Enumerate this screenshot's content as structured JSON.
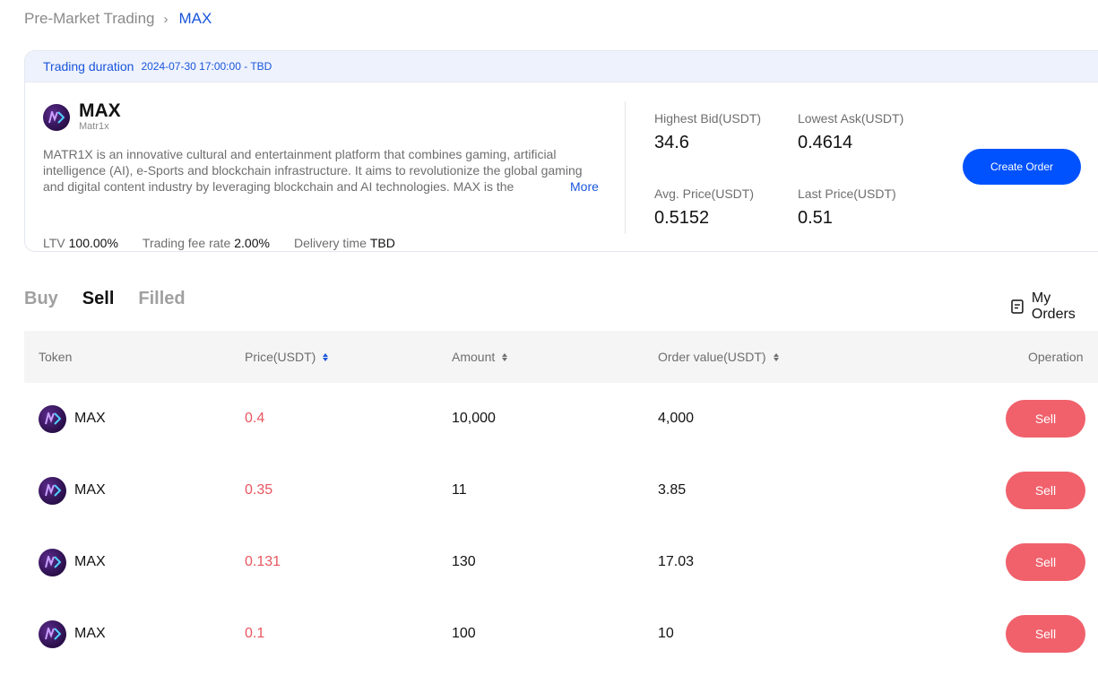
{
  "breadcrumb": {
    "parent": "Pre-Market Trading",
    "separator": "›",
    "current": "MAX"
  },
  "card": {
    "duration_label": "Trading duration",
    "duration_value": "2024-07-30 17:00:00 - TBD",
    "token": {
      "symbol": "MAX",
      "name": "Matr1x",
      "logo_icon": "matr1x-logo-icon"
    },
    "description": "MATR1X is an innovative cultural and entertainment platform that combines gaming, artificial intelligence (AI), e-Sports and blockchain infrastructure. It aims to revolutionize the global gaming and digital content industry by leveraging blockchain and AI technologies. MAX is the",
    "more_label": "More",
    "metrics": [
      {
        "label": "LTV",
        "value": "100.00%"
      },
      {
        "label": "Trading fee rate",
        "value": "2.00%"
      },
      {
        "label": "Delivery time",
        "value": "TBD"
      }
    ],
    "stats": {
      "highest_bid": {
        "label": "Highest Bid(USDT)",
        "value": "34.6"
      },
      "lowest_ask": {
        "label": "Lowest Ask(USDT)",
        "value": "0.4614"
      },
      "avg_price": {
        "label": "Avg. Price(USDT)",
        "value": "0.5152"
      },
      "last_price": {
        "label": "Last Price(USDT)",
        "value": "0.51"
      }
    },
    "create_order_label": "Create Order"
  },
  "tabs": [
    {
      "label": "Buy",
      "active": false
    },
    {
      "label": "Sell",
      "active": true
    },
    {
      "label": "Filled",
      "active": false
    }
  ],
  "my_orders_label": "My Orders",
  "table": {
    "headers": {
      "token": "Token",
      "price": "Price(USDT)",
      "amount": "Amount",
      "order_value": "Order value(USDT)",
      "operation": "Operation"
    },
    "rows": [
      {
        "token": "MAX",
        "price": "0.4",
        "amount": "10,000",
        "order_value": "4,000",
        "action": "Sell"
      },
      {
        "token": "MAX",
        "price": "0.35",
        "amount": "11",
        "order_value": "3.85",
        "action": "Sell"
      },
      {
        "token": "MAX",
        "price": "0.131",
        "amount": "130",
        "order_value": "17.03",
        "action": "Sell"
      },
      {
        "token": "MAX",
        "price": "0.1",
        "amount": "100",
        "order_value": "10",
        "action": "Sell"
      }
    ]
  },
  "colors": {
    "accent_blue": "#1a56db",
    "primary_button": "#0052ff",
    "sell_red": "#f0616c",
    "price_red": "#e8565f"
  }
}
